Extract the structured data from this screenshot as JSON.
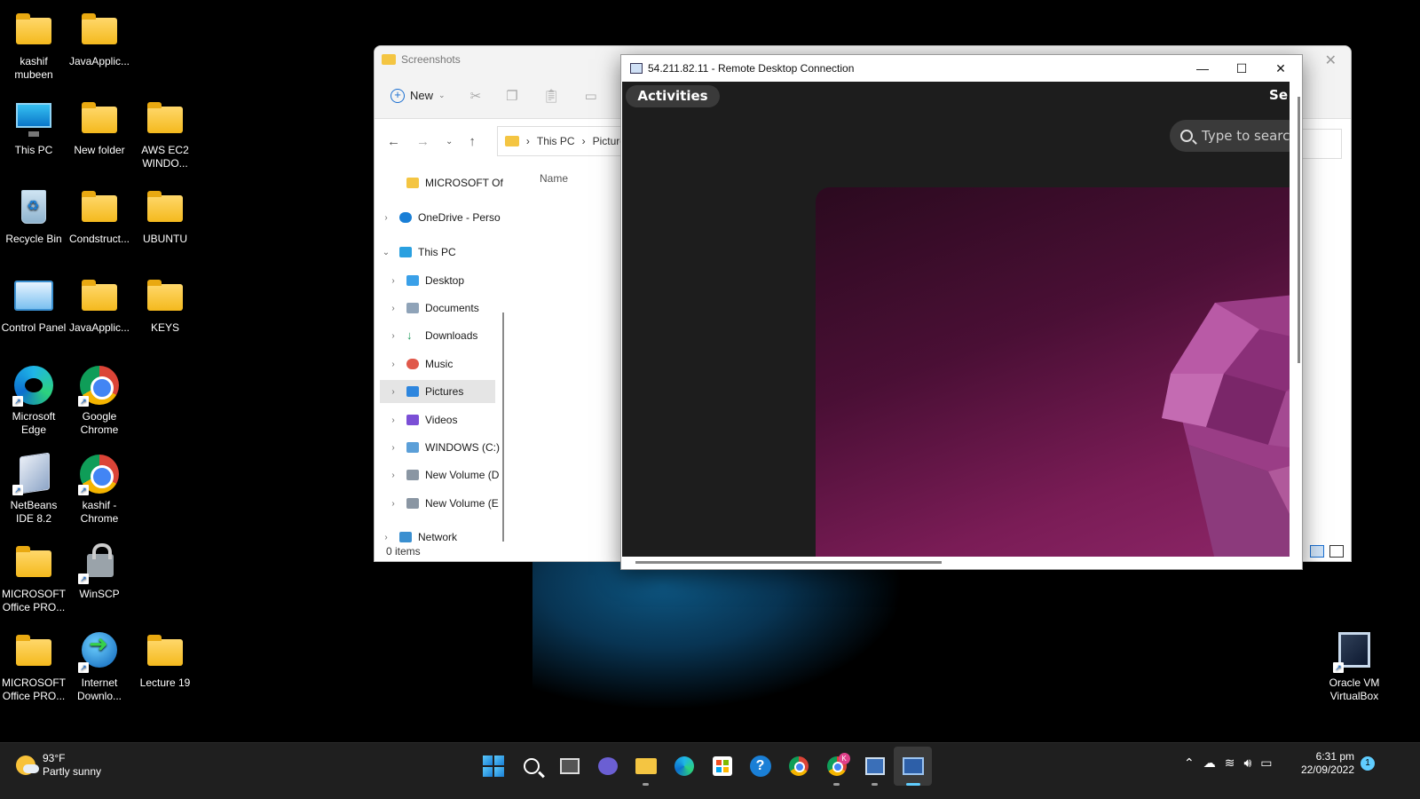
{
  "desktop": {
    "icons": [
      {
        "label": "kashif mubeen"
      },
      {
        "label": "JavaApplic..."
      },
      {
        "label": "This PC"
      },
      {
        "label": "New folder"
      },
      {
        "label": "AWS EC2 WINDO..."
      },
      {
        "label": "Recycle Bin"
      },
      {
        "label": "Condstruct..."
      },
      {
        "label": "UBUNTU"
      },
      {
        "label": "Control Panel"
      },
      {
        "label": "JavaApplic..."
      },
      {
        "label": "KEYS"
      },
      {
        "label": "Microsoft Edge"
      },
      {
        "label": "Google Chrome"
      },
      {
        "label": "NetBeans IDE 8.2"
      },
      {
        "label": "kashif - Chrome"
      },
      {
        "label": "MICROSOFT Office PRO..."
      },
      {
        "label": "WinSCP"
      },
      {
        "label": "MICROSOFT Office PRO..."
      },
      {
        "label": "Internet Downlo..."
      },
      {
        "label": "Lecture 19"
      },
      {
        "label": "Oracle VM VirtualBox"
      }
    ]
  },
  "explorer": {
    "title": "Screenshots",
    "toolbar": {
      "new_label": "New"
    },
    "address": {
      "this_pc": "This PC",
      "pictures": "Pictures"
    },
    "column_name": "Name",
    "nav": [
      {
        "label": "MICROSOFT Of"
      },
      {
        "label": "OneDrive - Perso"
      },
      {
        "label": "This PC"
      },
      {
        "label": "Desktop"
      },
      {
        "label": "Documents"
      },
      {
        "label": "Downloads"
      },
      {
        "label": "Music"
      },
      {
        "label": "Pictures"
      },
      {
        "label": "Videos"
      },
      {
        "label": "WINDOWS (C:)"
      },
      {
        "label": "New Volume (D"
      },
      {
        "label": "New Volume (E"
      },
      {
        "label": "Network"
      }
    ],
    "status": "0 items"
  },
  "rdp": {
    "title": "54.211.82.11 - Remote Desktop Connection",
    "activities": "Activities",
    "top_right_text": "Se",
    "search_placeholder": "Type to searc"
  },
  "taskbar": {
    "weather_temp": "93°F",
    "weather_desc": "Partly sunny",
    "chrome_profile_badge": "K",
    "time": "6:31 pm",
    "date": "22/09/2022",
    "notification_count": "1"
  },
  "colors": {
    "accent": "#60cdff",
    "folder": "#f4c542",
    "ubuntu_purple": "#7a1c56"
  }
}
